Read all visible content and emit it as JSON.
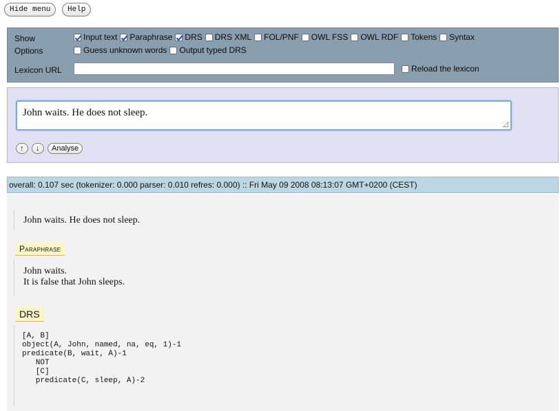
{
  "top_buttons": {
    "hide_menu": "Hide menu",
    "help": "Help"
  },
  "options": {
    "show_label": "Show",
    "options_label": "Options",
    "show_checkboxes": [
      {
        "label": "Input text",
        "checked": true
      },
      {
        "label": "Paraphrase",
        "checked": true
      },
      {
        "label": "DRS",
        "checked": true
      },
      {
        "label": "DRS XML",
        "checked": false
      },
      {
        "label": "FOL/PNF",
        "checked": false
      },
      {
        "label": "OWL FSS",
        "checked": false
      },
      {
        "label": "OWL RDF",
        "checked": false
      },
      {
        "label": "Tokens",
        "checked": false
      },
      {
        "label": "Syntax",
        "checked": false
      }
    ],
    "option_checkboxes": [
      {
        "label": "Guess unknown words",
        "checked": false
      },
      {
        "label": "Output typed DRS",
        "checked": false
      }
    ],
    "lexicon_label": "Lexicon URL",
    "lexicon_value": "",
    "reload_label": "Reload the lexicon",
    "reload_checked": false
  },
  "input": {
    "text": "John waits. He does not sleep.",
    "up_label": "↑",
    "down_label": "↓",
    "analyse_label": "Analyse"
  },
  "status": "overall: 0.107 sec (tokenizer: 0.000 parser: 0.010 refres: 0.000) :: Fri May 09 2008 08:13:07 GMT+0200 (CEST)",
  "output": {
    "input_echo": "John waits. He does not sleep.",
    "paraphrase_label": "Paraphrase",
    "paraphrase_lines": [
      "John waits.",
      "It is false that John sleeps."
    ],
    "drs_label": "DRS",
    "drs_lines": [
      "[A, B]",
      "object(A, John, named, na, eq, 1)-1",
      "predicate(B, wait, A)-1",
      "   NOT",
      "   [C]",
      "   predicate(C, sleep, A)-2"
    ]
  }
}
